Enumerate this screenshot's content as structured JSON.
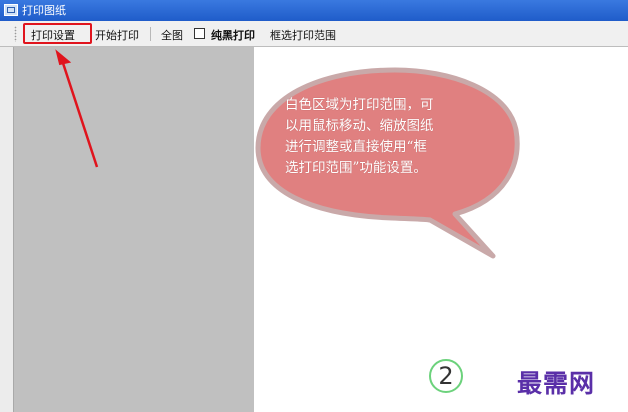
{
  "window": {
    "title": "打印图纸"
  },
  "toolbar": {
    "print_settings": "打印设置",
    "start_print": "开始打印",
    "full_view": "全图",
    "pure_black_print": "纯黑打印",
    "select_print_range": "框选打印范围",
    "pure_black_checked": false
  },
  "callout": {
    "lines": [
      "白色区域为打印范围，可",
      "以用鼠标移动、缩放图纸",
      "进行调整或直接使用“框",
      "选打印范围”功能设置。"
    ]
  },
  "step_number": "2",
  "watermark": "最需网",
  "colors": {
    "highlight": "#e0141d",
    "bubble_fill": "#e08080",
    "bubble_border": "#c9a9a9",
    "gray_panel": "#c0c0c0",
    "watermark": "#5a2fa8"
  }
}
